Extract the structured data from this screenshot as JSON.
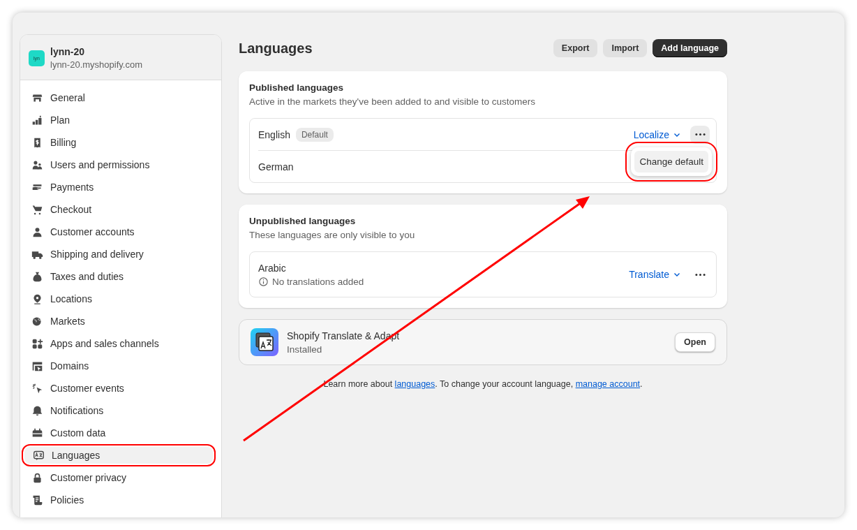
{
  "store": {
    "avatar": "lyn",
    "name": "lynn-20",
    "domain": "lynn-20.myshopify.com"
  },
  "sidebar": {
    "items": [
      {
        "label": "General",
        "selected": false,
        "outlined": false
      },
      {
        "label": "Plan",
        "selected": false,
        "outlined": false
      },
      {
        "label": "Billing",
        "selected": false,
        "outlined": false
      },
      {
        "label": "Users and permissions",
        "selected": false,
        "outlined": false
      },
      {
        "label": "Payments",
        "selected": false,
        "outlined": false
      },
      {
        "label": "Checkout",
        "selected": false,
        "outlined": false
      },
      {
        "label": "Customer accounts",
        "selected": false,
        "outlined": false
      },
      {
        "label": "Shipping and delivery",
        "selected": false,
        "outlined": false
      },
      {
        "label": "Taxes and duties",
        "selected": false,
        "outlined": false
      },
      {
        "label": "Locations",
        "selected": false,
        "outlined": false
      },
      {
        "label": "Markets",
        "selected": false,
        "outlined": false
      },
      {
        "label": "Apps and sales channels",
        "selected": false,
        "outlined": false
      },
      {
        "label": "Domains",
        "selected": false,
        "outlined": false
      },
      {
        "label": "Customer events",
        "selected": false,
        "outlined": false
      },
      {
        "label": "Notifications",
        "selected": false,
        "outlined": false
      },
      {
        "label": "Custom data",
        "selected": false,
        "outlined": false
      },
      {
        "label": "Languages",
        "selected": true,
        "outlined": true
      },
      {
        "label": "Customer privacy",
        "selected": false,
        "outlined": false
      },
      {
        "label": "Policies",
        "selected": false,
        "outlined": false
      }
    ]
  },
  "page": {
    "title": "Languages",
    "buttons": [
      {
        "label": "Export",
        "kind": "secondary"
      },
      {
        "label": "Import",
        "kind": "secondary"
      },
      {
        "label": "Add language",
        "kind": "primary"
      }
    ]
  },
  "published": {
    "title": "Published languages",
    "subtitle": "Active in the markets they've been added to and visible to customers",
    "rows": [
      {
        "name": "English",
        "badge": "Default",
        "action": "Localize",
        "menu_open": true
      },
      {
        "name": "German"
      }
    ],
    "menu": {
      "items": [
        "Change default"
      ],
      "outlined": true
    }
  },
  "unpublished": {
    "title": "Unpublished languages",
    "subtitle": "These languages are only visible to you",
    "rows": [
      {
        "name": "Arabic",
        "note": "No translations added",
        "action": "Translate",
        "menu_open": false
      }
    ]
  },
  "app": {
    "name": "Shopify Translate & Adapt",
    "status": "Installed",
    "button": "Open"
  },
  "footer": {
    "parts": [
      {
        "kind": "text",
        "text": "Learn more about "
      },
      {
        "kind": "link",
        "text": "languages"
      },
      {
        "kind": "text",
        "text": ". To change your account language, "
      },
      {
        "kind": "link",
        "text": "manage account"
      },
      {
        "kind": "text",
        "text": "."
      }
    ]
  },
  "annotation_arrow": true
}
